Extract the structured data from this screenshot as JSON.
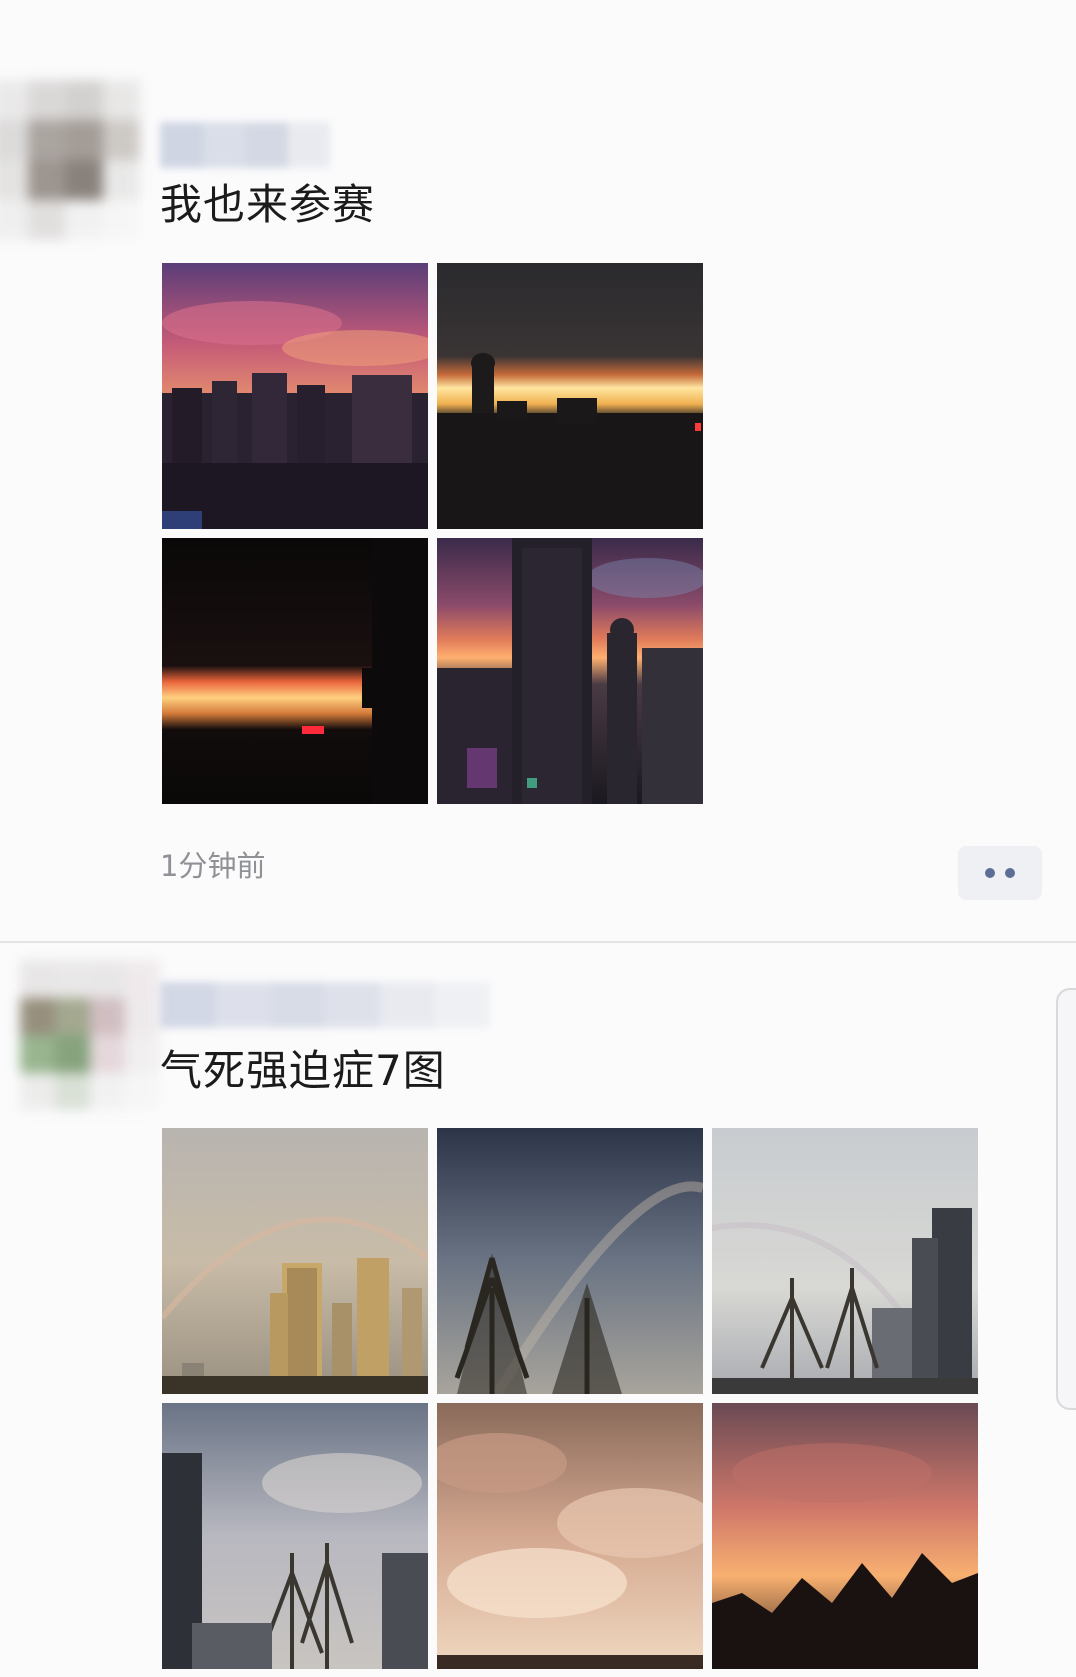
{
  "posts": [
    {
      "text": "我也来参赛",
      "timestamp": "1分钟前",
      "photo_count": 4
    },
    {
      "text": "气死强迫症7图",
      "photo_count": 6
    }
  ],
  "icons": {
    "more": "more-dots-icon"
  },
  "colors": {
    "background": "#fbfbfc",
    "timestamp": "#8f9197",
    "more_dots": "#5c6d96"
  }
}
